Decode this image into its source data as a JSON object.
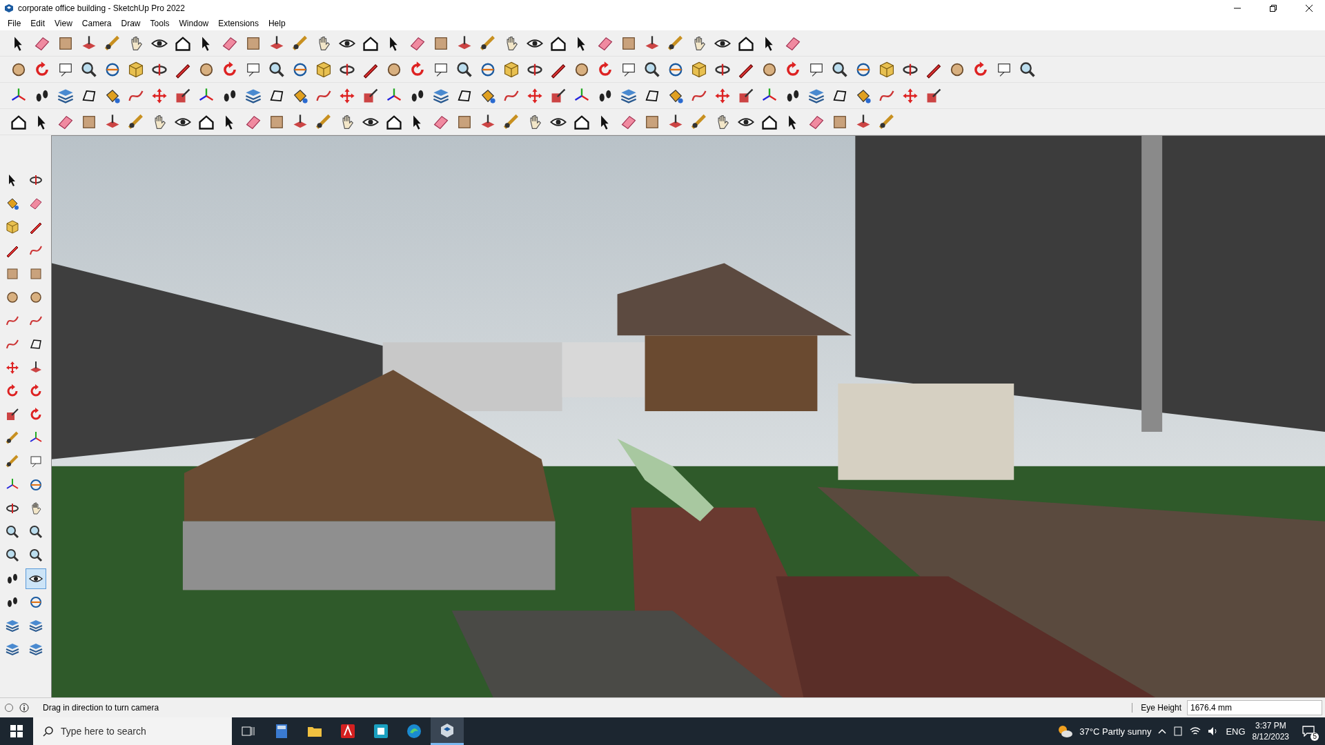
{
  "window": {
    "title": "corporate office building - SketchUp Pro 2022"
  },
  "menu": [
    "File",
    "Edit",
    "View",
    "Camera",
    "Draw",
    "Tools",
    "Window",
    "Extensions",
    "Help"
  ],
  "left_toolbar": [
    {
      "kind": "select",
      "selected": false
    },
    {
      "kind": "orbit",
      "selected": false
    },
    {
      "kind": "paint",
      "selected": false
    },
    {
      "kind": "eraser",
      "selected": false
    },
    {
      "kind": "cube",
      "selected": false
    },
    {
      "kind": "pencil",
      "selected": false
    },
    {
      "kind": "pencil",
      "selected": false
    },
    {
      "kind": "curve",
      "selected": false
    },
    {
      "kind": "rect",
      "selected": false
    },
    {
      "kind": "rect",
      "selected": false
    },
    {
      "kind": "circle",
      "selected": false
    },
    {
      "kind": "circle",
      "selected": false
    },
    {
      "kind": "curve",
      "selected": false
    },
    {
      "kind": "curve",
      "selected": false
    },
    {
      "kind": "curve",
      "selected": false
    },
    {
      "kind": "shape",
      "selected": false
    },
    {
      "kind": "move",
      "selected": false
    },
    {
      "kind": "pushpull",
      "selected": false
    },
    {
      "kind": "rotate",
      "selected": false
    },
    {
      "kind": "rotate",
      "selected": false
    },
    {
      "kind": "scale",
      "selected": false
    },
    {
      "kind": "rotate",
      "selected": false
    },
    {
      "kind": "tape",
      "selected": false
    },
    {
      "kind": "axes",
      "selected": false
    },
    {
      "kind": "tape",
      "selected": false
    },
    {
      "kind": "text",
      "selected": false
    },
    {
      "kind": "axes",
      "selected": false
    },
    {
      "kind": "section",
      "selected": false
    },
    {
      "kind": "orbit",
      "selected": false
    },
    {
      "kind": "pan",
      "selected": false
    },
    {
      "kind": "zoom",
      "selected": false
    },
    {
      "kind": "zoom",
      "selected": false
    },
    {
      "kind": "zoom",
      "selected": false
    },
    {
      "kind": "zoom",
      "selected": false
    },
    {
      "kind": "walk",
      "selected": false
    },
    {
      "kind": "look",
      "selected": true
    },
    {
      "kind": "walk",
      "selected": false
    },
    {
      "kind": "section",
      "selected": false
    },
    {
      "kind": "layers",
      "selected": false
    },
    {
      "kind": "layers",
      "selected": false
    },
    {
      "kind": "layers",
      "selected": false
    },
    {
      "kind": "layers",
      "selected": false
    }
  ],
  "status_bar": {
    "message": "Drag in direction to turn camera",
    "eye_height_label": "Eye Height",
    "eye_height_value": "1676.4 mm"
  },
  "taskbar": {
    "search": {
      "placeholder": "Type here to search"
    },
    "weather": "37°C  Partly sunny",
    "language": "ENG",
    "time": "3:37 PM",
    "date": "8/12/2023",
    "notifications": "5"
  }
}
